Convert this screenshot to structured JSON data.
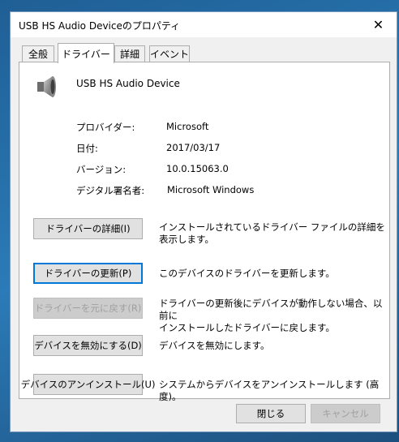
{
  "window": {
    "title": "USB HS Audio Deviceのプロパティ",
    "close_glyph": "✕"
  },
  "tabs": [
    {
      "label": "全般",
      "active": false
    },
    {
      "label": "ドライバー",
      "active": true
    },
    {
      "label": "詳細",
      "active": false
    },
    {
      "label": "イベント",
      "active": false
    }
  ],
  "device": {
    "name": "USB HS Audio Device",
    "icon": "speaker-icon"
  },
  "properties": [
    {
      "label": "プロバイダー:",
      "value": "Microsoft"
    },
    {
      "label": "日付:",
      "value": "2017/03/17"
    },
    {
      "label": "バージョン:",
      "value": "10.0.15063.0"
    },
    {
      "label": "デジタル署名者:",
      "value": "Microsoft Windows"
    }
  ],
  "actions": [
    {
      "button": "ドライバーの詳細(I)",
      "description": "インストールされているドライバー ファイルの詳細を表示します。",
      "enabled": true,
      "focused": false
    },
    {
      "button": "ドライバーの更新(P)",
      "description": "このデバイスのドライバーを更新します。",
      "enabled": true,
      "focused": true
    },
    {
      "button": "ドライバーを元に戻す(R)",
      "description": "ドライバーの更新後にデバイスが動作しない場合、以前に\nインストールしたドライバーに戻します。",
      "enabled": false,
      "focused": false
    },
    {
      "button": "デバイスを無効にする(D)",
      "description": "デバイスを無効にします。",
      "enabled": true,
      "focused": false
    },
    {
      "button": "デバイスのアンインストール(U)",
      "description": "システムからデバイスをアンインストールします (高度)。",
      "enabled": true,
      "focused": false
    }
  ],
  "footer": {
    "close_label": "閉じる",
    "cancel_label": "キャンセル",
    "cancel_enabled": false
  },
  "colors": {
    "focus_border": "#0078d7",
    "disabled_text": "#a0a0a0"
  }
}
